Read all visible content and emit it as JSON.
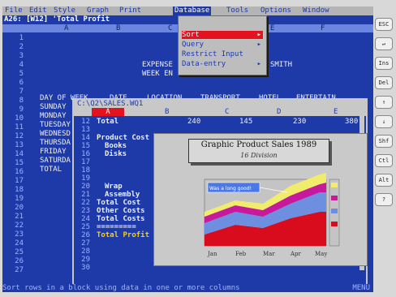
{
  "menubar": [
    "File",
    "Edit",
    "Style",
    "Graph",
    "Print",
    "Database",
    "Tools",
    "Options",
    "Window"
  ],
  "cell_ref": "A26: [W12] 'Total Profit",
  "columns": [
    "A",
    "B",
    "C",
    "D",
    "E",
    "F"
  ],
  "rows": [
    "1",
    "2",
    "3",
    "4",
    "5",
    "6",
    "7",
    "8",
    "9",
    "10",
    "11",
    "12",
    "13",
    "14",
    "15",
    "16",
    "17",
    "18",
    "19",
    "20",
    "21",
    "22",
    "23",
    "24",
    "25",
    "26",
    "27"
  ],
  "sheet": {
    "title1": "EXPENSE",
    "title1b": "SMITH",
    "title2": "WEEK EN",
    "headers": [
      "DAY OF WEEK",
      "DATE",
      "LOCATION",
      "TRANSPORT",
      "HOTEL",
      "ENTERTAIN"
    ],
    "days": [
      "SUNDAY",
      "MONDAY",
      "TUESDAY",
      "WEDNESD",
      "THURSDA",
      "FRIDAY",
      "SATURDA"
    ],
    "total": "TOTAL"
  },
  "db_menu": {
    "items": [
      "Sort",
      "Query",
      "Restrict Input",
      "Data-entry"
    ]
  },
  "window": {
    "title": "C:\\Q2\\SALES.WQ1",
    "cols": [
      "A",
      "B",
      "C",
      "D",
      "E"
    ],
    "rows": [
      "12",
      "13",
      "14",
      "15",
      "16",
      "17",
      "18",
      "19",
      "20",
      "21",
      "22",
      "23",
      "24",
      "25",
      "26",
      "27",
      "28",
      "29",
      "30"
    ],
    "r12": {
      "label": "Total",
      "v1": "240",
      "v2": "145",
      "v3": "230",
      "v4": "380"
    },
    "product_cost": "Product Cost",
    "books": "Books",
    "disks": "Disks",
    "wrap": "Wrap",
    "assembly": "Assembly",
    "total_cost": "Total Cost",
    "other_costs": "Other Costs",
    "total_costs": "Total Costs",
    "dashes": "=========",
    "total_profit": "Total Profit"
  },
  "chart_data": {
    "type": "area",
    "title": "Graphic Product Sales 1989",
    "subtitle": "16 Division",
    "categories": [
      "Jan",
      "Feb",
      "Mar",
      "Apr",
      "May"
    ],
    "annotation": "Was a long good!",
    "colors": [
      "#d80c1c",
      "#6e8ee0",
      "#c8189c",
      "#f2ec6c"
    ],
    "legend_placement": "right"
  },
  "status_text": "Sort rows in a block using data in one or more columns",
  "status_mode": "MENU",
  "side_buttons": [
    "ESC",
    "↵",
    "Ins",
    "Del",
    "↑",
    "↓",
    "Shf",
    "Ctl",
    "Alt",
    "?"
  ]
}
